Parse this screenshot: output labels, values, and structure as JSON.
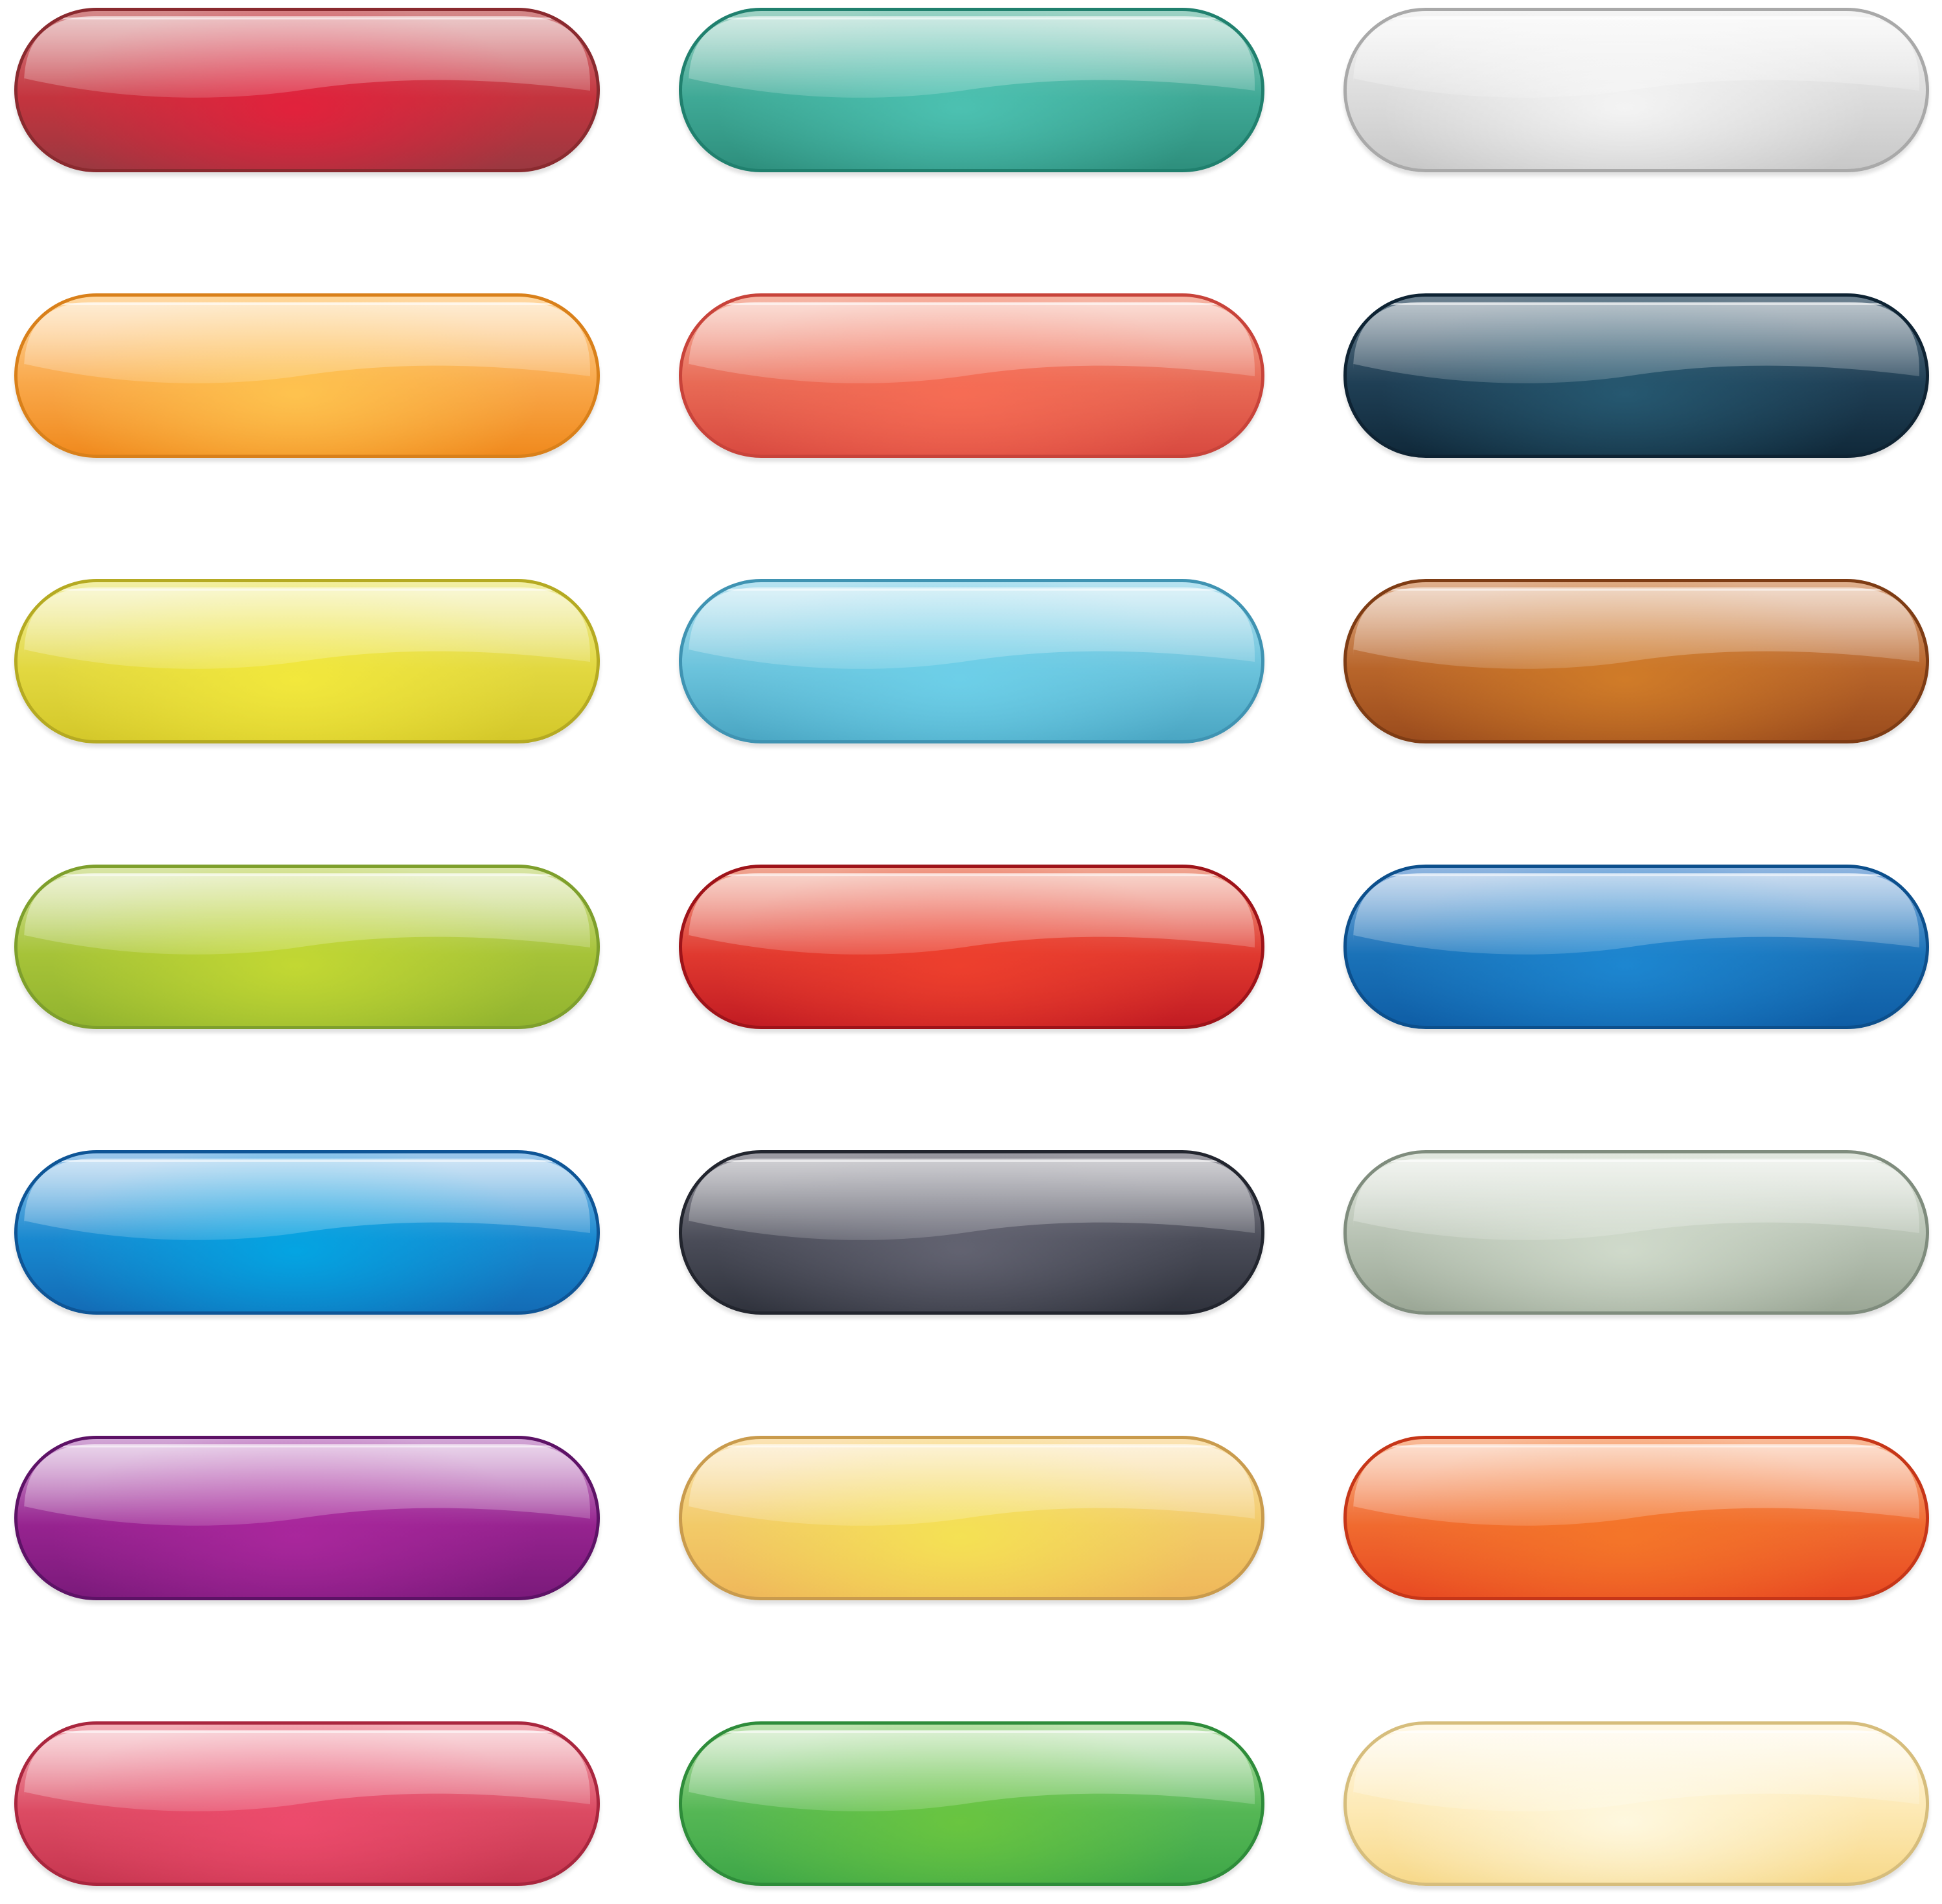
{
  "buttons": [
    {
      "name": "red-glossy-button",
      "edge": "#8a2a2f",
      "light": "#d4898a",
      "mid": "#c4343e",
      "dark": "#9b3840",
      "glow": "rgba(232,30,60,0.85)"
    },
    {
      "name": "teal-glossy-button",
      "edge": "#20806e",
      "light": "#9fd3c5",
      "mid": "#3fa996",
      "dark": "#2e8f7d",
      "glow": "rgba(80,200,185,0.8)"
    },
    {
      "name": "silver-glossy-button",
      "edge": "#a9a9a9",
      "light": "#f4f4f4",
      "mid": "#dcdcdc",
      "dark": "#c8c8c8",
      "glow": "rgba(255,255,255,0.7)"
    },
    {
      "name": "orange-glossy-button",
      "edge": "#d9801a",
      "light": "#ffd9a3",
      "mid": "#f9a84a",
      "dark": "#f08a1e",
      "glow": "rgba(255,200,80,0.85)"
    },
    {
      "name": "coral-glossy-button",
      "edge": "#c8433a",
      "light": "#f6b7a6",
      "mid": "#e86a55",
      "dark": "#d94a40",
      "glow": "rgba(250,110,85,0.8)"
    },
    {
      "name": "dark-navy-glossy-button",
      "edge": "#0e2333",
      "light": "#6d8190",
      "mid": "#1f3f55",
      "dark": "#10293a",
      "glow": "rgba(40,95,120,0.8)"
    },
    {
      "name": "yellow-glossy-button",
      "edge": "#b5aa22",
      "light": "#f2efa6",
      "mid": "#e2d840",
      "dark": "#d4c82a",
      "glow": "rgba(245,235,60,0.85)"
    },
    {
      "name": "sky-blue-glossy-button",
      "edge": "#3f93b2",
      "light": "#b7e3f1",
      "mid": "#6bc3dc",
      "dark": "#4aa6c3",
      "glow": "rgba(110,210,235,0.85)"
    },
    {
      "name": "brown-glossy-button",
      "edge": "#7e3c14",
      "light": "#e0b08e",
      "mid": "#b8652a",
      "dark": "#9b4c1d",
      "glow": "rgba(215,130,40,0.8)"
    },
    {
      "name": "lime-glossy-button",
      "edge": "#7e9f2c",
      "light": "#d9e5a6",
      "mid": "#a6c338",
      "dark": "#92b42f",
      "glow": "rgba(200,220,50,0.85)"
    },
    {
      "name": "bright-red-glossy-button",
      "edge": "#9e1319",
      "light": "#f0a691",
      "mid": "#e0392f",
      "dark": "#c21c23",
      "glow": "rgba(240,65,45,0.85)"
    },
    {
      "name": "blue-glossy-button",
      "edge": "#0c4f8c",
      "light": "#8fb5e0",
      "mid": "#1a72b8",
      "dark": "#0f5ea6",
      "glow": "rgba(30,140,215,0.8)"
    },
    {
      "name": "azure-glossy-button",
      "edge": "#0e5596",
      "light": "#9cc8ec",
      "mid": "#1888cf",
      "dark": "#136cb6",
      "glow": "rgba(0,170,230,0.85)"
    },
    {
      "name": "charcoal-glossy-button",
      "edge": "#22252e",
      "light": "#9d9ca4",
      "mid": "#4a4c58",
      "dark": "#30333d",
      "glow": "rgba(110,110,125,0.7)"
    },
    {
      "name": "sage-glossy-button",
      "edge": "#7f8c7d",
      "light": "#e2e8df",
      "mid": "#b6c1b2",
      "dark": "#9ba796",
      "glow": "rgba(215,225,210,0.8)"
    },
    {
      "name": "purple-glossy-button",
      "edge": "#5d1266",
      "light": "#d2a7d6",
      "mid": "#96238f",
      "dark": "#7b1a7b",
      "glow": "rgba(175,40,160,0.8)"
    },
    {
      "name": "gold-glossy-button",
      "edge": "#c99b4d",
      "light": "#fbe3b3",
      "mid": "#f2ca68",
      "dark": "#efb85a",
      "glow": "rgba(245,230,80,0.85)"
    },
    {
      "name": "red-orange-glossy-button",
      "edge": "#c63618",
      "light": "#f9bb98",
      "mid": "#f06a2f",
      "dark": "#e84a22",
      "glow": "rgba(245,120,40,0.85)"
    },
    {
      "name": "rose-glossy-button",
      "edge": "#a9263e",
      "light": "#f4b0b8",
      "mid": "#dc4b63",
      "dark": "#c73650",
      "glow": "rgba(240,75,110,0.85)"
    },
    {
      "name": "green-glossy-button",
      "edge": "#2e8c3a",
      "light": "#bfe3b0",
      "mid": "#55b755",
      "dark": "#3fa748",
      "glow": "rgba(110,200,60,0.85)"
    },
    {
      "name": "cream-glossy-button",
      "edge": "#d6bd7c",
      "light": "#fff8e6",
      "mid": "#fde9b4",
      "dark": "#f7d98b",
      "glow": "rgba(255,252,235,0.8)"
    }
  ]
}
